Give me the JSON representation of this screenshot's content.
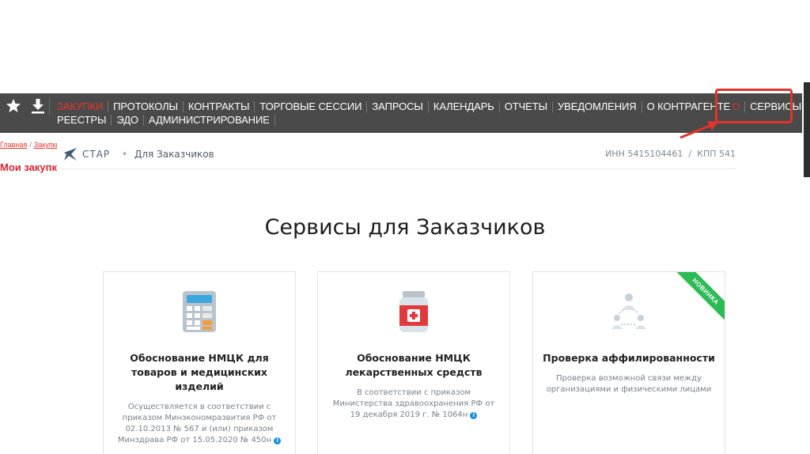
{
  "nav": {
    "row1": [
      {
        "label": "ЗАКУПКИ",
        "active": true
      },
      {
        "label": "ПРОТОКОЛЫ"
      },
      {
        "label": "КОНТРАКТЫ"
      },
      {
        "label": "ТОРГОВЫЕ СЕССИИ"
      },
      {
        "label": "ЗАПРОСЫ"
      },
      {
        "label": "КАЛЕНДАРЬ"
      },
      {
        "label": "ОТЧЕТЫ"
      },
      {
        "label": "УВЕДОМЛЕНИЯ"
      },
      {
        "label": "О КОНТРАГЕНТЕ"
      },
      {
        "label": "СЕРВИСЫ"
      }
    ],
    "row2": [
      {
        "label": "РЕЕСТРЫ"
      },
      {
        "label": "ЭДО"
      },
      {
        "label": "АДМИНИСТРИРОВАНИЕ"
      }
    ],
    "icons": [
      "star-icon",
      "download-icon"
    ],
    "accent_color": "#e8342e"
  },
  "breadcrumb": {
    "home": "Главная",
    "current": "Закупки"
  },
  "page_heading": "Мои закупки",
  "subheader": {
    "logo_text": "СТАР",
    "section": "Для Заказчиков",
    "inn": "ИНН 5415104461",
    "kpp": "КПП 541"
  },
  "main_title": "Сервисы для Заказчиков",
  "cards": [
    {
      "icon": "calculator-icon",
      "title": "Обоснование НМЦК для товаров и медицинских изделий",
      "description": "Осуществляется в соответствии с приказом Минэкономразвития РФ от 02.10.2013 № 567 и (или) приказом Минздрава РФ от 15.05.2020 № 450н"
    },
    {
      "icon": "medicine-bottle-icon",
      "title": "Обоснование НМЦК лекарственных средств",
      "description": "В соответствии с приказом Министерства здравоохранения РФ от 19 декабря 2019 г. № 1064н"
    },
    {
      "icon": "network-people-icon",
      "title": "Проверка аффилированности",
      "description": "Проверка возможной связи между организациями и физическими лицами",
      "ribbon": "НОВИНКА"
    }
  ]
}
